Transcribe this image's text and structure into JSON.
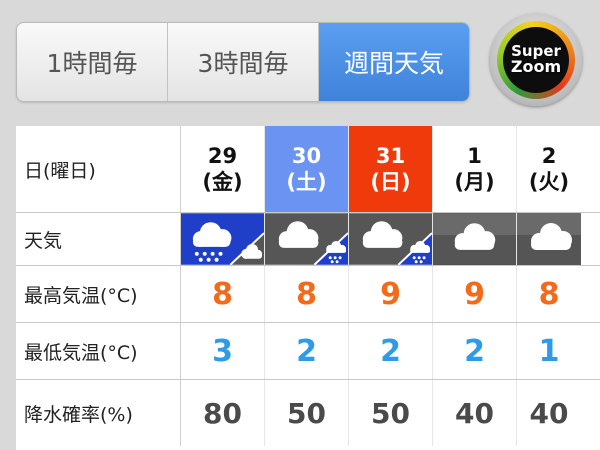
{
  "tabs": [
    {
      "label": "1時間毎",
      "active": false
    },
    {
      "label": "3時間毎",
      "active": false
    },
    {
      "label": "週間天気",
      "active": true
    }
  ],
  "super_zoom": {
    "line1": "Super",
    "line2": "Zoom"
  },
  "table": {
    "row_labels": {
      "date": "日(曜日)",
      "weather": "天気",
      "high": "最高気温(°C)",
      "low": "最低気温(°C)",
      "precip": "降水確率(%)"
    },
    "days": [
      {
        "day": "29",
        "dow": "(金)",
        "type": "weekday",
        "weather": "snow-then-cloudy",
        "high": "8",
        "low": "3",
        "precip": "80"
      },
      {
        "day": "30",
        "dow": "(土)",
        "type": "saturday",
        "weather": "cloudy-then-snow",
        "high": "8",
        "low": "2",
        "precip": "50"
      },
      {
        "day": "31",
        "dow": "(日)",
        "type": "sunday",
        "weather": "cloudy-then-snow",
        "high": "9",
        "low": "2",
        "precip": "50"
      },
      {
        "day": "1",
        "dow": "(月)",
        "type": "weekday",
        "weather": "cloudy",
        "high": "9",
        "low": "2",
        "precip": "40"
      },
      {
        "day": "2",
        "dow": "(火)",
        "type": "weekday",
        "weather": "cloudy",
        "high": "8",
        "low": "1",
        "precip": "40"
      }
    ]
  },
  "colors": {
    "active_tab": "#4a90e2",
    "saturday": "#6b93f2",
    "sunday": "#f03a0b",
    "high_temp": "#f36a1b",
    "low_temp": "#2f9be6"
  }
}
